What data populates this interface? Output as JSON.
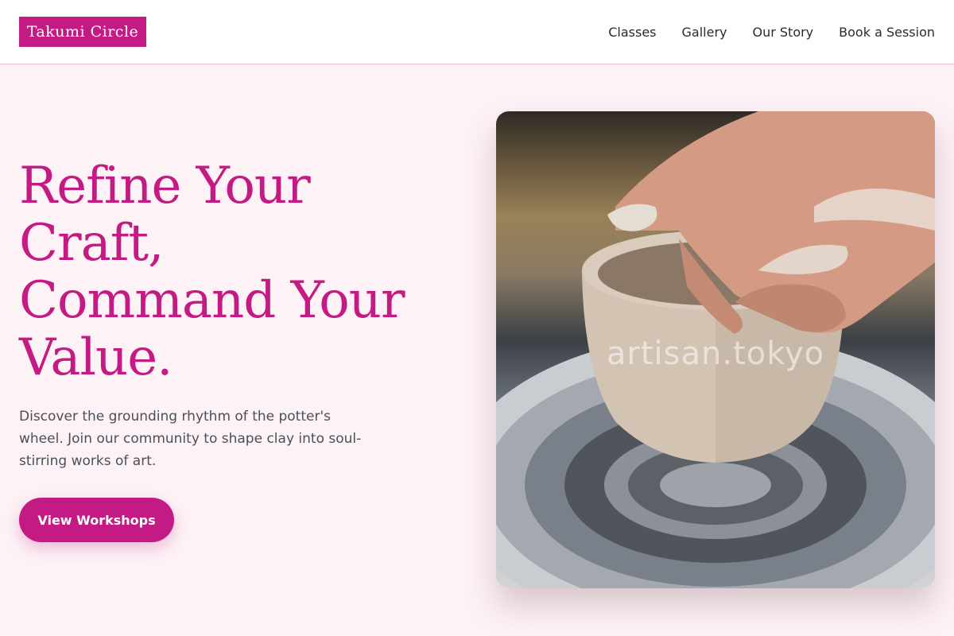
{
  "brand": {
    "name": "Takumi Circle"
  },
  "nav": {
    "items": [
      "Classes",
      "Gallery",
      "Our Story",
      "Book a Session"
    ]
  },
  "hero": {
    "title": "Refine Your\nCraft,\nCommand Your\nValue.",
    "description": "Discover the grounding rhythm of the potter's wheel. Join our community to shape clay into soul-stirring works of art.",
    "cta_label": "View Workshops",
    "image": {
      "subject": "hands shaping a clay bowl on a spinning potter's wheel",
      "watermark": "artisan.tokyo"
    }
  },
  "colors": {
    "accent": "#c41a84",
    "page_background": "#fdf2f6",
    "header_background": "#ffffff",
    "body_text": "#4b4f59"
  }
}
